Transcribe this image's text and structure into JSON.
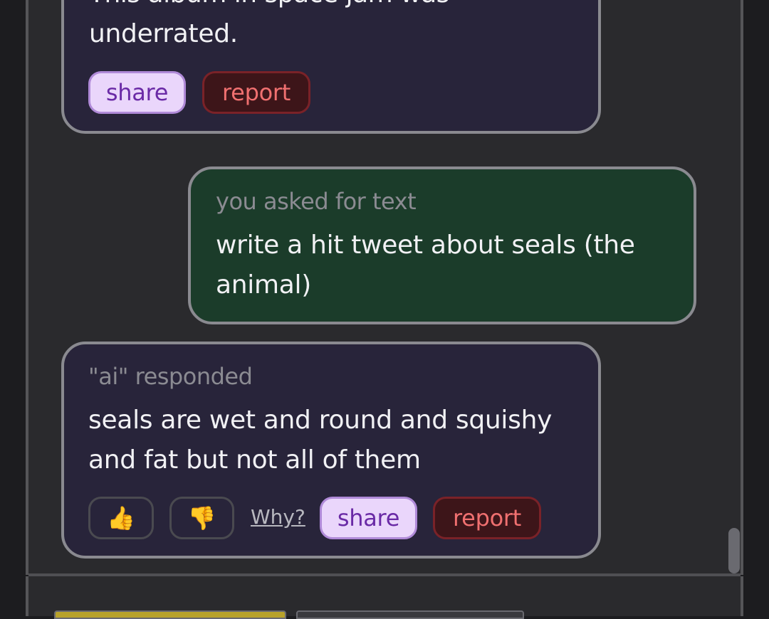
{
  "messages": [
    {
      "role": "ai",
      "partial_text": "underrated.",
      "share_label": "share",
      "report_label": "report"
    },
    {
      "role": "user",
      "meta": "you asked for text",
      "text_line1": "write a hit tweet about seals (the",
      "text_line2": "animal)"
    },
    {
      "role": "ai",
      "meta": "\"ai\" responded",
      "text_line1": "seals are wet and round and squishy",
      "text_line2": "and fat but not all of them",
      "thumbs_up": "👍",
      "thumbs_down": "👎",
      "why_label": "Why?",
      "share_label": "share",
      "report_label": "report"
    }
  ],
  "colors": {
    "share_bg": "#ead6fb",
    "report_bg": "#3d1519",
    "user_bubble": "#1b3c2a",
    "ai_bubble": "#28243a",
    "yellow_tab": "#b8a22a"
  }
}
